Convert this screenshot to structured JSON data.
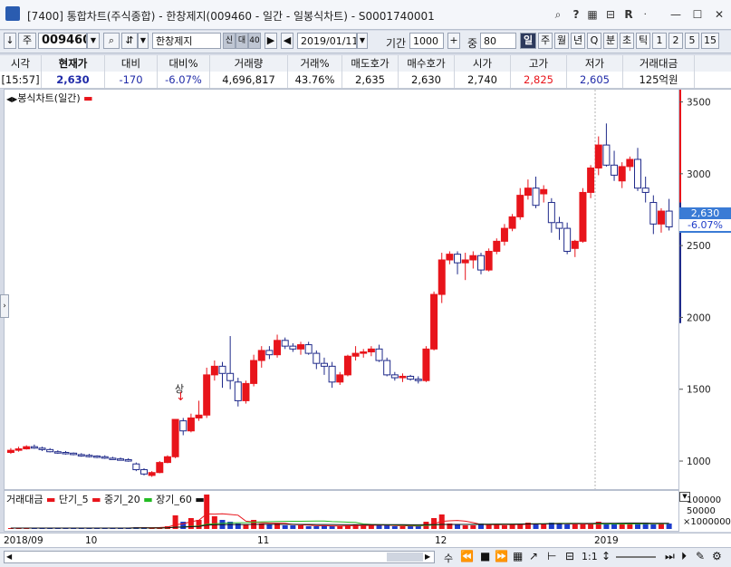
{
  "window": {
    "title": "[7400] 통합차트(주식종합) - 한창제지(009460 - 일간 - 일봉식차트) - S0001740001"
  },
  "toolbar": {
    "mode": "주",
    "code": "009460",
    "name": "한창제지",
    "tag_credit": "신",
    "tag_40": "40",
    "date": "2019/01/11",
    "period_label": "기간",
    "period_value": "1000",
    "zoom_label": "중",
    "zoom_value": "80",
    "periods": [
      "일",
      "주",
      "월",
      "년",
      "Q",
      "분",
      "초",
      "틱",
      "1",
      "2",
      "5",
      "15"
    ],
    "selected_period": "일"
  },
  "quote": {
    "headers": [
      "시각",
      "현재가",
      "대비",
      "대비%",
      "거래량",
      "거래%",
      "매도호가",
      "매수호가",
      "시가",
      "고가",
      "저가",
      "거래대금"
    ],
    "values": [
      "[15:57]",
      "2,630",
      "-170",
      "-6.07%",
      "4,696,817",
      "43.76%",
      "2,635",
      "2,630",
      "2,740",
      "2,825",
      "2,605",
      "125억원"
    ]
  },
  "chart": {
    "series_label": "봉식차트(일간)",
    "annotation": "상",
    "current_price": "2,630",
    "current_change": "-6.07%",
    "y_ticks": [
      3500,
      3000,
      2500,
      2000,
      1500,
      1000
    ],
    "y_tick_labels": [
      "3500",
      "3000",
      "2500",
      "2000",
      "1500",
      "1000"
    ],
    "colors": {
      "up": "#e8141b",
      "down": "#1f2a8a",
      "price_tag": "#3a7bd5"
    }
  },
  "volume": {
    "legend": [
      "거래대금",
      "단기_5",
      "중기_20",
      "장기_60"
    ],
    "axis_labels": [
      "100000",
      "50000",
      "×1000000"
    ]
  },
  "xaxis": {
    "labels": [
      "2018/09",
      "10",
      "11",
      "12",
      "2019"
    ]
  },
  "bottom": {
    "zoom_ratio": "1:1",
    "nav_label": "수"
  },
  "chart_data": {
    "type": "candlestick",
    "ylim": [
      830,
      3560
    ],
    "candles": [
      {
        "o": 1060,
        "h": 1090,
        "l": 1050,
        "c": 1075
      },
      {
        "o": 1075,
        "h": 1100,
        "l": 1065,
        "c": 1085
      },
      {
        "o": 1085,
        "h": 1110,
        "l": 1080,
        "c": 1100
      },
      {
        "o": 1100,
        "h": 1115,
        "l": 1085,
        "c": 1090
      },
      {
        "o": 1090,
        "h": 1100,
        "l": 1070,
        "c": 1080
      },
      {
        "o": 1080,
        "h": 1090,
        "l": 1060,
        "c": 1065
      },
      {
        "o": 1065,
        "h": 1075,
        "l": 1050,
        "c": 1060
      },
      {
        "o": 1060,
        "h": 1070,
        "l": 1045,
        "c": 1055
      },
      {
        "o": 1055,
        "h": 1060,
        "l": 1040,
        "c": 1045
      },
      {
        "o": 1045,
        "h": 1055,
        "l": 1030,
        "c": 1040
      },
      {
        "o": 1040,
        "h": 1050,
        "l": 1025,
        "c": 1035
      },
      {
        "o": 1035,
        "h": 1040,
        "l": 1020,
        "c": 1030
      },
      {
        "o": 1030,
        "h": 1040,
        "l": 1015,
        "c": 1020
      },
      {
        "o": 1020,
        "h": 1030,
        "l": 1010,
        "c": 1015
      },
      {
        "o": 1015,
        "h": 1025,
        "l": 1005,
        "c": 1010
      },
      {
        "o": 1010,
        "h": 1020,
        "l": 995,
        "c": 1000
      },
      {
        "o": 980,
        "h": 990,
        "l": 930,
        "c": 940
      },
      {
        "o": 940,
        "h": 950,
        "l": 900,
        "c": 910
      },
      {
        "o": 900,
        "h": 930,
        "l": 890,
        "c": 920
      },
      {
        "o": 920,
        "h": 1000,
        "l": 915,
        "c": 990
      },
      {
        "o": 990,
        "h": 1040,
        "l": 985,
        "c": 1030
      },
      {
        "o": 1030,
        "h": 1290,
        "l": 1020,
        "c": 1290
      },
      {
        "o": 1280,
        "h": 1300,
        "l": 1180,
        "c": 1210
      },
      {
        "o": 1210,
        "h": 1330,
        "l": 1200,
        "c": 1300
      },
      {
        "o": 1300,
        "h": 1420,
        "l": 1280,
        "c": 1320
      },
      {
        "o": 1320,
        "h": 1650,
        "l": 1300,
        "c": 1600
      },
      {
        "o": 1600,
        "h": 1700,
        "l": 1560,
        "c": 1660
      },
      {
        "o": 1660,
        "h": 1690,
        "l": 1510,
        "c": 1610
      },
      {
        "o": 1610,
        "h": 1870,
        "l": 1500,
        "c": 1560
      },
      {
        "o": 1550,
        "h": 1580,
        "l": 1380,
        "c": 1420
      },
      {
        "o": 1420,
        "h": 1560,
        "l": 1400,
        "c": 1540
      },
      {
        "o": 1540,
        "h": 1740,
        "l": 1520,
        "c": 1700
      },
      {
        "o": 1700,
        "h": 1800,
        "l": 1650,
        "c": 1770
      },
      {
        "o": 1770,
        "h": 1800,
        "l": 1710,
        "c": 1740
      },
      {
        "o": 1740,
        "h": 1880,
        "l": 1720,
        "c": 1840
      },
      {
        "o": 1840,
        "h": 1860,
        "l": 1780,
        "c": 1800
      },
      {
        "o": 1800,
        "h": 1820,
        "l": 1760,
        "c": 1780
      },
      {
        "o": 1780,
        "h": 1830,
        "l": 1740,
        "c": 1810
      },
      {
        "o": 1810,
        "h": 1830,
        "l": 1740,
        "c": 1750
      },
      {
        "o": 1750,
        "h": 1770,
        "l": 1640,
        "c": 1680
      },
      {
        "o": 1680,
        "h": 1720,
        "l": 1600,
        "c": 1660
      },
      {
        "o": 1660,
        "h": 1690,
        "l": 1510,
        "c": 1550
      },
      {
        "o": 1550,
        "h": 1620,
        "l": 1530,
        "c": 1600
      },
      {
        "o": 1600,
        "h": 1740,
        "l": 1590,
        "c": 1730
      },
      {
        "o": 1730,
        "h": 1800,
        "l": 1700,
        "c": 1750
      },
      {
        "o": 1750,
        "h": 1780,
        "l": 1720,
        "c": 1760
      },
      {
        "o": 1760,
        "h": 1800,
        "l": 1730,
        "c": 1780
      },
      {
        "o": 1780,
        "h": 1810,
        "l": 1690,
        "c": 1700
      },
      {
        "o": 1700,
        "h": 1720,
        "l": 1590,
        "c": 1600
      },
      {
        "o": 1600,
        "h": 1620,
        "l": 1560,
        "c": 1580
      },
      {
        "o": 1580,
        "h": 1610,
        "l": 1550,
        "c": 1590
      },
      {
        "o": 1590,
        "h": 1600,
        "l": 1560,
        "c": 1570
      },
      {
        "o": 1570,
        "h": 1590,
        "l": 1540,
        "c": 1560
      },
      {
        "o": 1560,
        "h": 1800,
        "l": 1550,
        "c": 1780
      },
      {
        "o": 1780,
        "h": 2180,
        "l": 1770,
        "c": 2160
      },
      {
        "o": 2160,
        "h": 2450,
        "l": 2100,
        "c": 2400
      },
      {
        "o": 2400,
        "h": 2460,
        "l": 2370,
        "c": 2440
      },
      {
        "o": 2440,
        "h": 2460,
        "l": 2300,
        "c": 2380
      },
      {
        "o": 2380,
        "h": 2450,
        "l": 2260,
        "c": 2400
      },
      {
        "o": 2400,
        "h": 2460,
        "l": 2340,
        "c": 2430
      },
      {
        "o": 2430,
        "h": 2450,
        "l": 2300,
        "c": 2330
      },
      {
        "o": 2330,
        "h": 2480,
        "l": 2320,
        "c": 2460
      },
      {
        "o": 2460,
        "h": 2550,
        "l": 2440,
        "c": 2530
      },
      {
        "o": 2530,
        "h": 2650,
        "l": 2500,
        "c": 2620
      },
      {
        "o": 2620,
        "h": 2720,
        "l": 2600,
        "c": 2700
      },
      {
        "o": 2700,
        "h": 2900,
        "l": 2680,
        "c": 2850
      },
      {
        "o": 2850,
        "h": 2960,
        "l": 2820,
        "c": 2900
      },
      {
        "o": 2900,
        "h": 2980,
        "l": 2760,
        "c": 2780
      },
      {
        "o": 2860,
        "h": 2920,
        "l": 2800,
        "c": 2890
      },
      {
        "o": 2800,
        "h": 2830,
        "l": 2590,
        "c": 2660
      },
      {
        "o": 2660,
        "h": 2700,
        "l": 2540,
        "c": 2620
      },
      {
        "o": 2620,
        "h": 2660,
        "l": 2440,
        "c": 2460
      },
      {
        "o": 2480,
        "h": 2540,
        "l": 2420,
        "c": 2530
      },
      {
        "o": 2530,
        "h": 2900,
        "l": 2520,
        "c": 2870
      },
      {
        "o": 2870,
        "h": 3060,
        "l": 2830,
        "c": 3040
      },
      {
        "o": 3040,
        "h": 3260,
        "l": 2990,
        "c": 3200
      },
      {
        "o": 3200,
        "h": 3350,
        "l": 3050,
        "c": 3060
      },
      {
        "o": 3060,
        "h": 3160,
        "l": 2950,
        "c": 2990
      },
      {
        "o": 2950,
        "h": 3080,
        "l": 2900,
        "c": 3050
      },
      {
        "o": 3050,
        "h": 3120,
        "l": 3020,
        "c": 3100
      },
      {
        "o": 3100,
        "h": 3180,
        "l": 2880,
        "c": 2900
      },
      {
        "o": 2900,
        "h": 2980,
        "l": 2800,
        "c": 2870
      },
      {
        "o": 2800,
        "h": 2850,
        "l": 2580,
        "c": 2650
      },
      {
        "o": 2650,
        "h": 2760,
        "l": 2590,
        "c": 2740
      },
      {
        "o": 2740,
        "h": 2825,
        "l": 2605,
        "c": 2630
      }
    ],
    "candle_x": [
      8,
      18,
      28,
      38,
      48,
      58,
      68,
      78,
      88,
      98,
      108,
      118,
      128,
      138,
      148,
      158,
      168,
      178,
      188,
      198,
      208,
      218,
      228,
      238,
      248,
      258,
      268,
      278,
      288,
      298,
      308,
      318,
      328,
      338,
      348,
      358,
      368,
      378,
      388,
      398,
      408,
      418,
      428,
      438,
      448,
      458,
      468,
      478,
      488,
      498,
      508,
      518,
      528,
      538,
      548,
      558,
      568,
      578,
      588,
      598,
      608,
      618,
      628,
      638,
      648,
      658,
      668,
      678,
      688,
      698,
      708,
      718,
      728,
      738,
      748,
      758,
      768,
      778,
      788,
      798,
      808,
      818,
      828,
      838,
      848
    ],
    "volume": [
      1,
      1,
      1,
      1,
      1,
      1,
      1,
      1,
      1,
      1,
      1,
      1,
      1,
      1,
      1,
      1,
      2,
      2,
      1,
      2,
      3,
      15,
      8,
      12,
      10,
      38,
      14,
      10,
      8,
      6,
      5,
      10,
      6,
      5,
      6,
      4,
      4,
      4,
      3,
      3,
      4,
      3,
      3,
      4,
      5,
      4,
      4,
      4,
      4,
      3,
      3,
      3,
      3,
      8,
      12,
      16,
      6,
      5,
      4,
      4,
      6,
      5,
      5,
      4,
      5,
      5,
      7,
      6,
      5,
      7,
      6,
      5,
      5,
      5,
      6,
      8,
      6,
      5,
      5,
      6,
      6,
      7,
      5,
      6,
      6
    ]
  }
}
